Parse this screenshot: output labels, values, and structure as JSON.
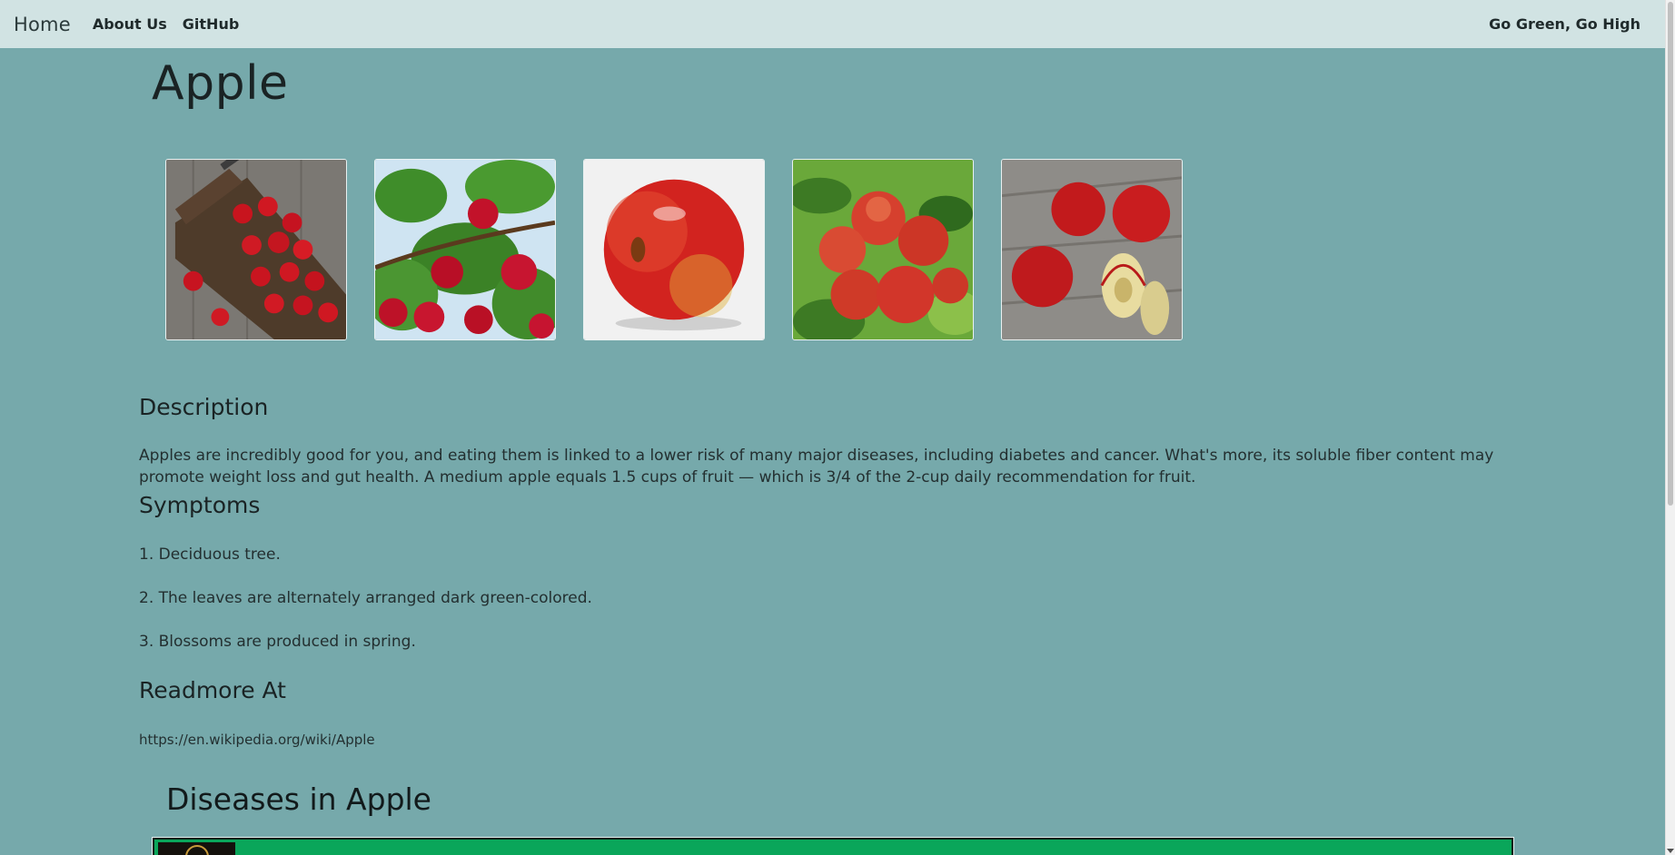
{
  "nav": {
    "brand": "Home",
    "links": [
      "About Us",
      "GitHub"
    ],
    "slogan": "Go Green, Go High"
  },
  "plant": {
    "title": "Apple",
    "images": [
      {
        "alt": "apples on wooden board with knife"
      },
      {
        "alt": "apples hanging on tree branches"
      },
      {
        "alt": "single red apple on white background"
      },
      {
        "alt": "cluster of apples with green leaves"
      },
      {
        "alt": "apples and sliced apple on wooden table"
      }
    ]
  },
  "description": {
    "heading": "Description",
    "text": "Apples are incredibly good for you, and eating them is linked to a lower risk of many major diseases, including diabetes and cancer. What's more, its soluble fiber content may promote weight loss and gut health. A medium apple equals 1.5 cups of fruit — which is 3/4 of the 2-cup daily recommendation for fruit."
  },
  "symptoms": {
    "heading": "Symptoms",
    "items": [
      "1. Deciduous tree.",
      "2. The leaves are alternately arranged dark green-colored.",
      "3. Blossoms are produced in spring."
    ]
  },
  "readmore": {
    "heading": "Readmore At",
    "url": "https://en.wikipedia.org/wiki/Apple"
  },
  "diseases": {
    "heading": "Diseases in Apple"
  },
  "colors": {
    "page_bg": "#76a9ab",
    "navbar_bg": "#d1e3e3",
    "disease_card_bg": "#0aa65a"
  }
}
